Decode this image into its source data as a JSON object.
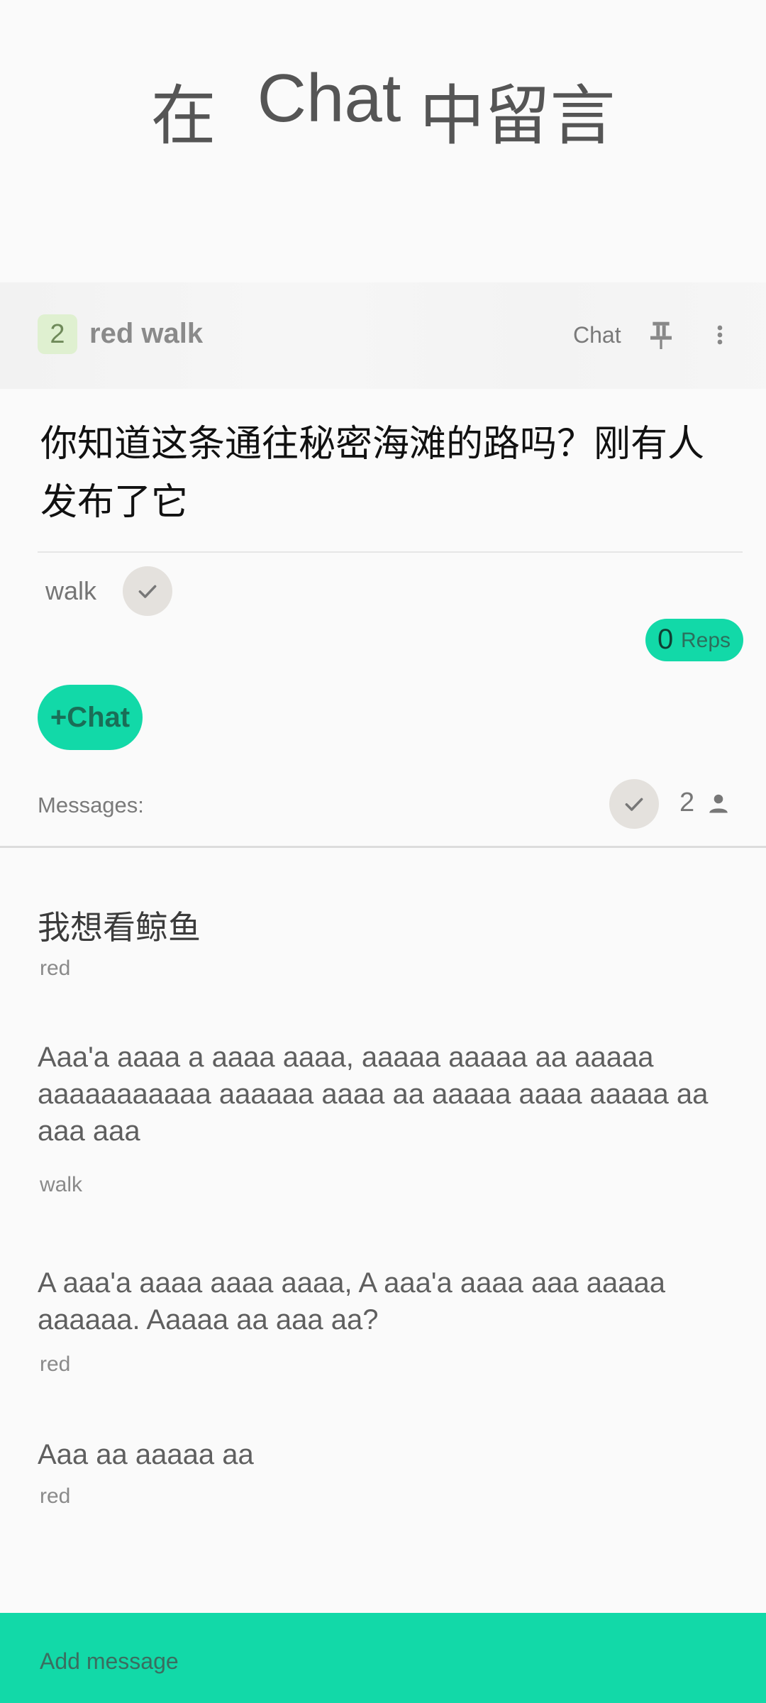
{
  "banner": {
    "title_prefix": "在",
    "title_app": "Chat",
    "title_suffix": "中留言"
  },
  "post": {
    "badge_count": "2",
    "name": "red walk",
    "chat_link": "Chat",
    "question": "你知道这条通往秘密海滩的路吗？刚有人发布了它",
    "tag": "walk",
    "reps_count": "0",
    "reps_label": "Reps",
    "add_chat_label": "+Chat",
    "messages_label": "Messages:",
    "participants_count": "2"
  },
  "messages": [
    {
      "text": "我想看鲸鱼",
      "author": "red"
    },
    {
      "text": "Aaa'a aaaa a aaaa aaaa, aaaaa aaaaa aa aaaaa aaaaaaaaaaa aaaaaa aaaa aa aaaaa aaaa aaaaa aa aaa aaa",
      "author": "walk"
    },
    {
      "text": "A aaa'a aaaa aaaa aaaa, A aaa'a aaaa aaa aaaaa aaaaaa. Aaaaa aa aaa aa?",
      "author": "red"
    },
    {
      "text": "Aaa aa aaaaa aa",
      "author": "red"
    }
  ],
  "composer": {
    "placeholder": "Add message"
  },
  "colors": {
    "accent": "#12d9a8",
    "badge_bg": "#dff0d0",
    "check_bg": "#e4e1dd"
  },
  "icons": {
    "pin": "pin-icon",
    "more": "more-vert-icon",
    "check": "check-icon",
    "person": "person-icon"
  }
}
